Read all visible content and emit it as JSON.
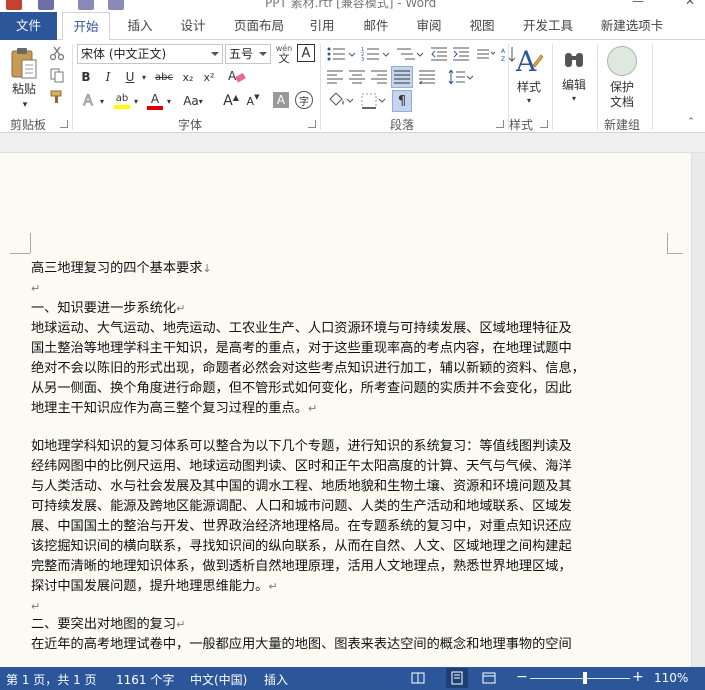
{
  "window": {
    "title": "PPT 素材.rtf [兼容模式] - Word"
  },
  "tabs": [
    {
      "label": "文件"
    },
    {
      "label": "开始"
    },
    {
      "label": "插入"
    },
    {
      "label": "设计"
    },
    {
      "label": "页面布局"
    },
    {
      "label": "引用"
    },
    {
      "label": "邮件"
    },
    {
      "label": "审阅"
    },
    {
      "label": "视图"
    },
    {
      "label": "开发工具"
    },
    {
      "label": "新建选项卡"
    }
  ],
  "ribbon": {
    "clipboard": {
      "label": "剪贴板",
      "paste_label": "粘贴"
    },
    "font": {
      "label": "字体",
      "font_name": "宋体 (中文正文)",
      "font_size": "五号",
      "wen_label": "wén",
      "wen_char": "文",
      "bold": "B",
      "italic": "I",
      "underline": "U",
      "strike": "abc",
      "subscript": "x₂",
      "superscript": "x²",
      "text_effect": "A",
      "highlight_label": "ab",
      "font_color_label": "A",
      "grow_font": "A",
      "shrink_font": "A",
      "char_shading": "A",
      "enclose_char": "字",
      "clear_format": "A",
      "change_case": "Aa",
      "highlight_color": "#ffff00",
      "font_color": "#e00000"
    },
    "paragraph": {
      "label": "段落"
    },
    "styles": {
      "label": "样式",
      "button_label": "样式"
    },
    "editing": {
      "label": "编辑"
    },
    "new_group": {
      "label": "新建组",
      "protect_label_1": "保护",
      "protect_label_2": "文档"
    }
  },
  "document": {
    "lines": [
      {
        "text": "高三地理复习的四个基本要求",
        "mark": "↓"
      },
      {
        "text": "",
        "mark": "↵"
      },
      {
        "text": "一、知识要进一步系统化",
        "mark": "↵"
      },
      {
        "text": "地球运动、大气运动、地壳运动、工农业生产、人口资源环境与可持续发展、区域地理特征及",
        "mark": ""
      },
      {
        "text": "国土整治等地理学科主干知识，是高考的重点，对于这些重现率高的考点内容，在地理试题中",
        "mark": ""
      },
      {
        "text": "绝对不会以陈旧的形式出现，命题者必然会对这些考点知识进行加工，辅以新颖的资料、信息，",
        "mark": ""
      },
      {
        "text": "从另一侧面、换个角度进行命题，但不管形式如何变化，所考查问题的实质并不会变化，因此",
        "mark": ""
      },
      {
        "text": "地理主干知识应作为高三整个复习过程的重点。",
        "mark": "↵"
      },
      {
        "text": "",
        "mark": ""
      },
      {
        "text": "如地理学科知识的复习体系可以整合为以下几个专题，进行知识的系统复习：等值线图判读及",
        "mark": ""
      },
      {
        "text": "经纬网图中的比例尺运用、地球运动图判读、区时和正午太阳高度的计算、天气与气候、海洋",
        "mark": ""
      },
      {
        "text": "与人类活动、水与社会发展及其中国的调水工程、地质地貌和生物土壤、资源和环境问题及其",
        "mark": ""
      },
      {
        "text": "可持续发展、能源及跨地区能源调配、人口和城市问题、人类的生产活动和地域联系、区域发",
        "mark": ""
      },
      {
        "text": "展、中国国土的整治与开发、世界政治经济地理格局。在专题系统的复习中，对重点知识还应",
        "mark": ""
      },
      {
        "text": "该挖掘知识间的横向联系，寻找知识间的纵向联系，从而在自然、人文、区域地理之间构建起",
        "mark": ""
      },
      {
        "text": "完整而清晰的地理知识体系，做到透析自然地理原理，活用人文地理点，熟悉世界地理区域，",
        "mark": ""
      },
      {
        "text": "探讨中国发展问题，提升地理思维能力。",
        "mark": "↵"
      },
      {
        "text": "",
        "mark": "↵"
      },
      {
        "text": "二、要突出对地图的复习",
        "mark": "↵"
      },
      {
        "text": "在近年的高考地理试卷中，一般都应用大量的地图、图表来表达空间的概念和地理事物的空间",
        "mark": ""
      }
    ]
  },
  "status": {
    "page": "第 1 页，共 1 页",
    "words": "1161 个字",
    "language": "中文(中国)",
    "mode": "插入",
    "zoom_minus": "−",
    "zoom_plus": "+",
    "zoom": "110%",
    "zoom_fraction": 0.55
  },
  "colors": {
    "accent": "#2b579a",
    "page_bg": "#fbfbf4"
  },
  "icons": {
    "save": "save-icon",
    "undo": "undo-icon",
    "redo": "redo-icon",
    "paste": "paste-icon",
    "cut": "scissors-icon",
    "copy": "copy-icon",
    "format_painter": "brush-icon"
  }
}
